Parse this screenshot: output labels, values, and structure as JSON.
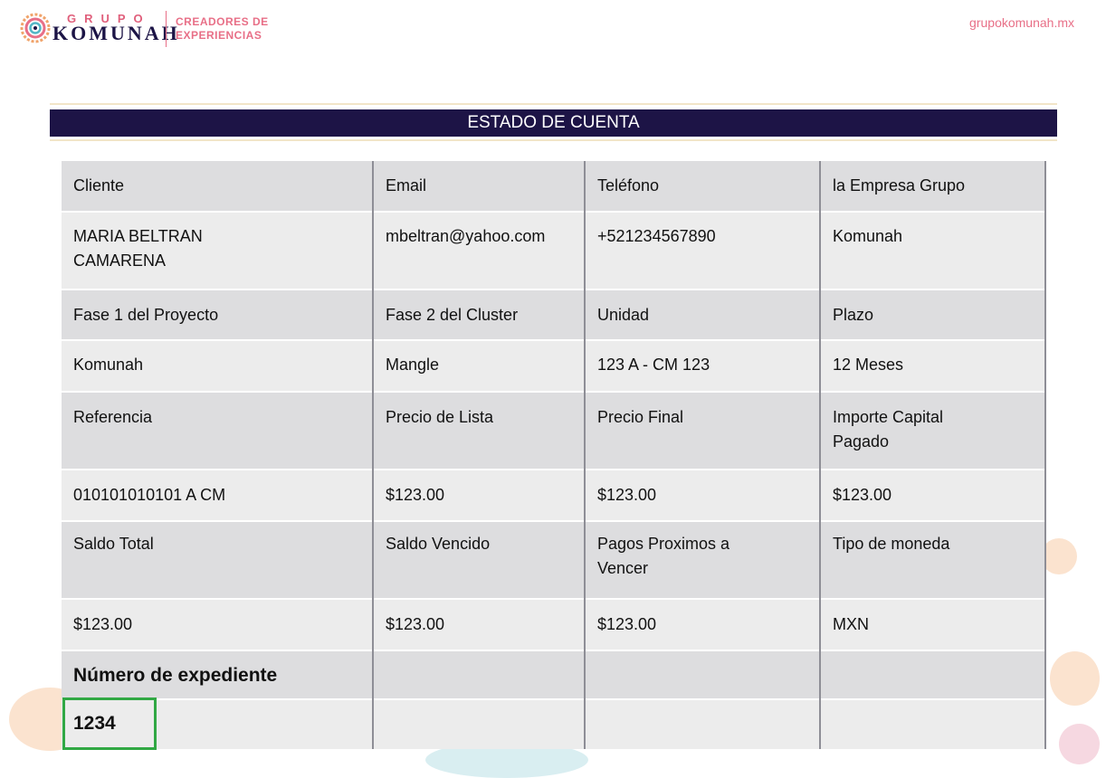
{
  "header": {
    "brand_top": "GRUPO",
    "brand_main": "KOMUNAH",
    "tagline_line1": "CREADORES DE",
    "tagline_line2": "EXPERIENCIAS",
    "site_url": "grupokomunah.mx"
  },
  "title": "ESTADO DE CUENTA",
  "rows": {
    "r1h": [
      "Cliente",
      "Email",
      "Teléfono",
      "la Empresa Grupo"
    ],
    "r1v": [
      "MARIA BELTRAN\nCAMARENA",
      "mbeltran@yahoo.com",
      "+521234567890",
      "Komunah"
    ],
    "r2h": [
      "Fase 1 del Proyecto",
      "Fase 2 del Cluster",
      "Unidad",
      "Plazo"
    ],
    "r2v": [
      "Komunah",
      "Mangle",
      "123 A - CM 123",
      "12 Meses"
    ],
    "r3h": [
      "Referencia",
      "Precio de Lista",
      "Precio Final",
      "Importe Capital\nPagado"
    ],
    "r3v": [
      "010101010101 A CM",
      "$123.00",
      "$123.00",
      "$123.00"
    ],
    "r4h": [
      "Saldo Total",
      "Saldo Vencido",
      "Pagos Proximos a\nVencer",
      "Tipo de moneda"
    ],
    "r4v": [
      "$123.00",
      "$123.00",
      "$123.00",
      "MXN"
    ],
    "r5h": [
      "Número de expediente",
      "",
      "",
      ""
    ],
    "r5v": [
      "1234",
      "",
      "",
      ""
    ]
  },
  "colors": {
    "brand_navy": "#1d1446",
    "brand_pink": "#e86f87",
    "highlight_green": "#31a844"
  },
  "icons": {
    "logo": "komunah-sun-logo-icon"
  }
}
